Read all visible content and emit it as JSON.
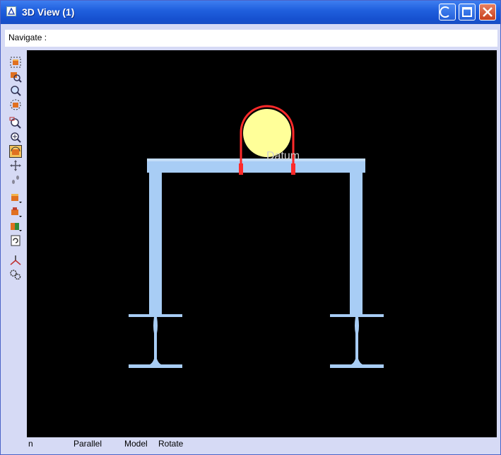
{
  "window": {
    "title": "3D View (1)"
  },
  "navigate": {
    "label": "Navigate :"
  },
  "toolbar": {
    "tools": [
      {
        "icon": "select-view-icon"
      },
      {
        "icon": "zoom-model-icon"
      },
      {
        "icon": "zoom-extents-icon"
      },
      {
        "icon": "view-box-icon"
      },
      {
        "icon": "zoom-window-icon"
      },
      {
        "icon": "zoom-in-icon"
      },
      {
        "icon": "rotate-view-icon",
        "active": true
      },
      {
        "icon": "pan-icon"
      },
      {
        "icon": "walk-icon"
      },
      {
        "icon": "layer-dropdown-icon"
      },
      {
        "icon": "filter-dropdown-icon"
      },
      {
        "icon": "clip-dropdown-icon"
      },
      {
        "icon": "refresh-icon"
      },
      {
        "icon": "axes-icon"
      },
      {
        "icon": "settings-gears-icon"
      }
    ]
  },
  "viewport": {
    "label": "Datum",
    "colors": {
      "background": "#000000",
      "steel": "#a8cdf5",
      "steel_edge": "#8fb5e0",
      "pipe": "#ffff99",
      "u_bolt": "#ff2a2a",
      "label": "#cfcfcf"
    }
  },
  "status": {
    "item1": "n",
    "projection": "Parallel",
    "mode": "Model",
    "action": "Rotate"
  }
}
